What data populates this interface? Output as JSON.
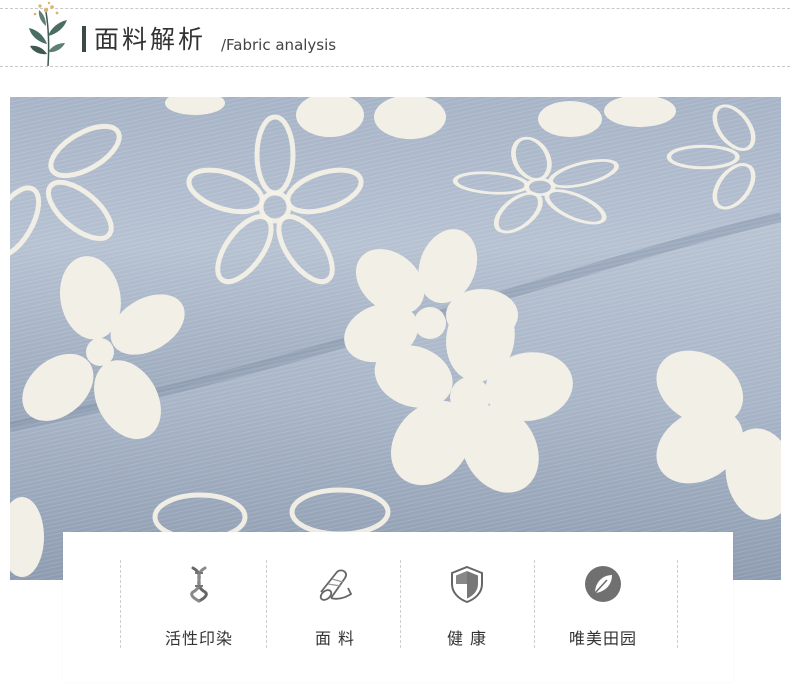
{
  "header": {
    "title_cn": "面料解析",
    "title_en": "/Fabric analysis"
  },
  "features": [
    {
      "icon": "dna-helix-icon",
      "label": "活性印染"
    },
    {
      "icon": "fabric-roll-icon",
      "label": "面 料"
    },
    {
      "icon": "shield-icon",
      "label": "健 康"
    },
    {
      "icon": "leaf-circle-icon",
      "label": "唯美田园"
    }
  ],
  "colors": {
    "fabric_blue": "#a9b6c8",
    "flower_cream": "#f2efe6",
    "accent_dark": "#3d4a43",
    "icon_gray": "#666666"
  }
}
